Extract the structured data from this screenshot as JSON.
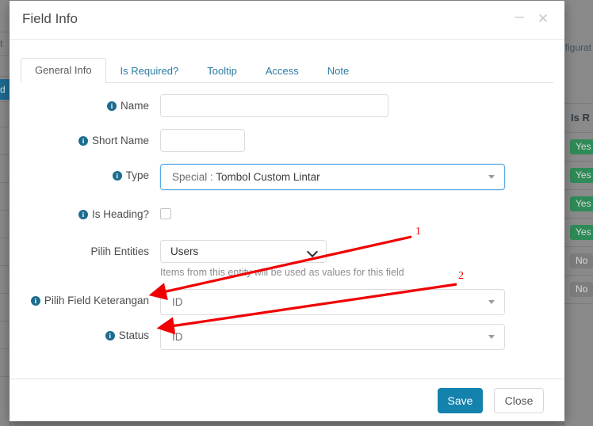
{
  "dialog": {
    "title": "Field Info",
    "minimize_icon": "minimize-icon",
    "minimize_glyph": "–",
    "close_icon": "close-icon",
    "close_glyph": "✕",
    "tabs": [
      {
        "label": "General Info",
        "active": true
      },
      {
        "label": "Is Required?",
        "active": false
      },
      {
        "label": "Tooltip",
        "active": false
      },
      {
        "label": "Access",
        "active": false
      },
      {
        "label": "Note",
        "active": false
      }
    ],
    "form": {
      "name": {
        "label": "Name",
        "value": "",
        "placeholder": ""
      },
      "short_name": {
        "label": "Short Name",
        "value": "",
        "placeholder": ""
      },
      "type": {
        "label": "Type",
        "prefix": "Special :",
        "value": "Tombol Custom Lintar"
      },
      "is_heading": {
        "label": "Is Heading?",
        "checked": false
      },
      "pilih_entities": {
        "label": "Pilih Entities",
        "value": "Users",
        "helper": "Items from this entity will be used as values for this field"
      },
      "pilih_field_keterangan": {
        "label": "Pilih Field Keterangan",
        "value": "ID"
      },
      "status": {
        "label": "Status",
        "value": "ID"
      }
    },
    "footer": {
      "save_label": "Save",
      "close_label": "Close"
    }
  },
  "annotations": [
    {
      "id": "1",
      "label": "1"
    },
    {
      "id": "2",
      "label": "2"
    }
  ],
  "background": {
    "left_text": "t",
    "left_active_text": "d",
    "breadcrumb": "figurat",
    "table": {
      "header": "Is R",
      "rows": [
        {
          "value": "Yes",
          "kind": "yes"
        },
        {
          "value": "Yes",
          "kind": "yes"
        },
        {
          "value": "Yes",
          "kind": "yes"
        },
        {
          "value": "Yes",
          "kind": "yes"
        },
        {
          "value": "No",
          "kind": "no"
        },
        {
          "value": "No",
          "kind": "no"
        }
      ]
    }
  },
  "colors": {
    "accent": "#1382ad",
    "info_icon": "#1b6d8f",
    "tab_link": "#2b7ba3",
    "annotation": "#f00000",
    "badge_yes": "#2e8b57",
    "badge_no": "#7d7d7d"
  }
}
